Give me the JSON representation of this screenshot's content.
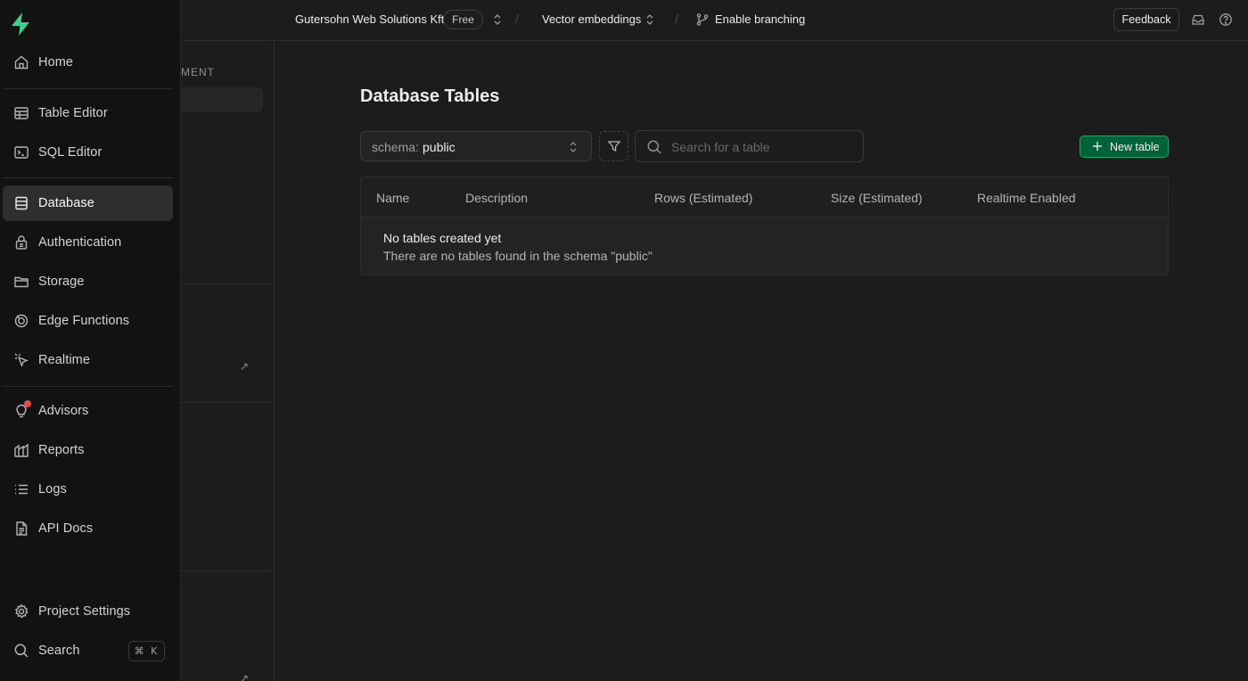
{
  "topbar": {
    "org_name": "Gutersohn Web Solutions Kft",
    "plan_badge": "Free",
    "project_name": "Vector embeddings",
    "branching_label": "Enable branching",
    "feedback_label": "Feedback"
  },
  "sidebar": {
    "items": [
      {
        "label": "Home",
        "icon": "home-icon"
      },
      {
        "label": "Table Editor",
        "icon": "table-icon"
      },
      {
        "label": "SQL Editor",
        "icon": "terminal-icon"
      },
      {
        "label": "Database",
        "icon": "database-icon",
        "active": true
      },
      {
        "label": "Authentication",
        "icon": "lock-icon"
      },
      {
        "label": "Storage",
        "icon": "folder-icon"
      },
      {
        "label": "Edge Functions",
        "icon": "edge-functions-icon"
      },
      {
        "label": "Realtime",
        "icon": "cursor-icon"
      },
      {
        "label": "Advisors",
        "icon": "lightbulb-icon",
        "notification": true
      },
      {
        "label": "Reports",
        "icon": "reports-icon"
      },
      {
        "label": "Logs",
        "icon": "list-icon"
      },
      {
        "label": "API Docs",
        "icon": "file-icon"
      }
    ],
    "bottom": {
      "settings_label": "Project Settings",
      "search_label": "Search",
      "shortcut": "⌘ K"
    }
  },
  "secondary_panel": {
    "header_fragment": "MENT"
  },
  "main": {
    "title": "Database Tables",
    "schema_key": "schema:",
    "schema_value": "public",
    "search_placeholder": "Search for a table",
    "new_table_label": "New table",
    "table": {
      "columns": [
        "Name",
        "Description",
        "Rows (Estimated)",
        "Size (Estimated)",
        "Realtime Enabled"
      ],
      "empty_title": "No tables created yet",
      "empty_subtitle": "There are no tables found in the schema \"public\""
    }
  },
  "colors": {
    "accent": "#3ecf8e",
    "primary_button": "#006239",
    "notification_dot": "#e5484d",
    "background": "#1c1c1c",
    "sidebar_background": "#121212"
  }
}
